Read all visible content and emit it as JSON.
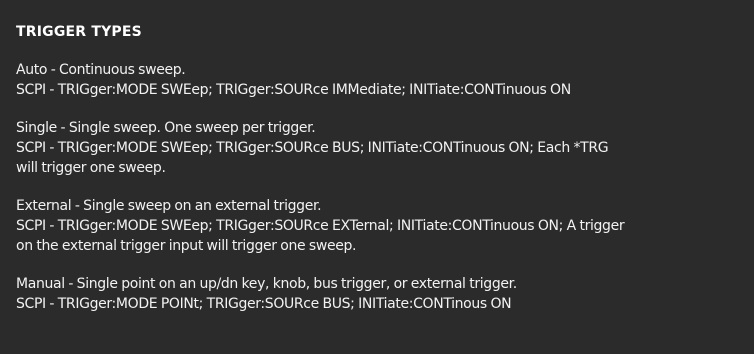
{
  "panel": {
    "title": "TRIGGER TYPES",
    "sections": [
      {
        "lines": [
          "Auto - Continuous sweep.",
          "SCPI - TRIGger:MODE SWEep; TRIGger:SOURce IMMediate; INITiate:CONTinuous ON"
        ]
      },
      {
        "lines": [
          "Single - Single sweep. One sweep per trigger.",
          "SCPI - TRIGger:MODE SWEep; TRIGger:SOURce BUS; INITiate:CONTinuous ON; Each *TRG",
          "will trigger one sweep."
        ]
      },
      {
        "lines": [
          "External - Single sweep on an external trigger.",
          "SCPI - TRIGger:MODE SWEep; TRIGger:SOURce EXTernal; INITiate:CONTinuous ON; A trigger",
          "on the external trigger input will trigger one sweep."
        ]
      },
      {
        "lines": [
          "Manual - Single point on an up/dn key, knob, bus trigger, or external trigger.",
          "SCPI - TRIGger:MODE POINt; TRIGger:SOURce BUS; INITiate:CONTinous ON"
        ]
      }
    ]
  }
}
